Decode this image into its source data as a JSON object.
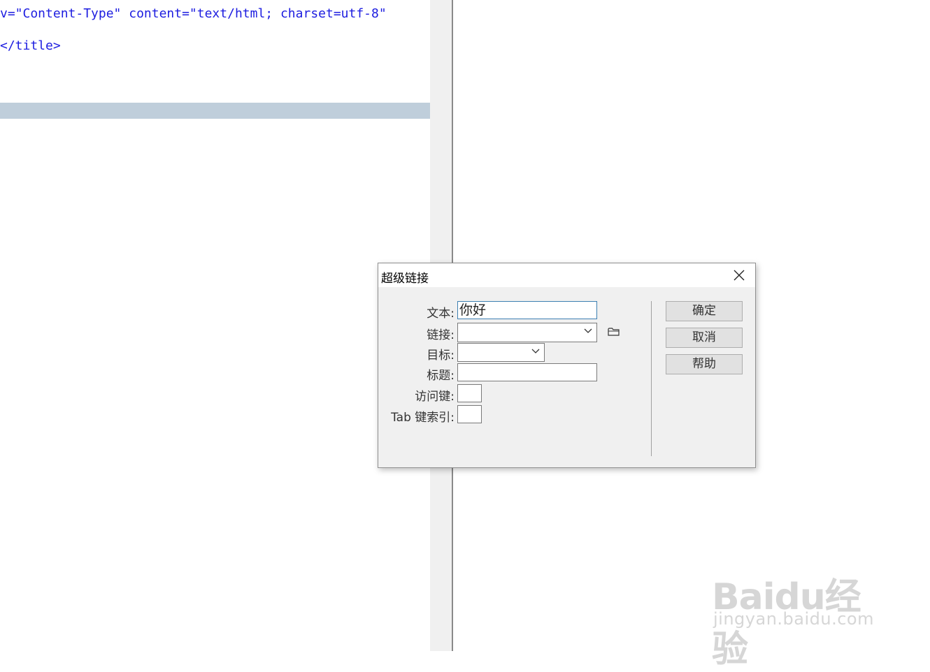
{
  "editor": {
    "lines": [
      "v=\"Content-Type\" content=\"text/html; charset=utf-8\"",
      "</title>"
    ]
  },
  "dialog": {
    "title": "超级链接",
    "fields": {
      "text_label": "文本:",
      "text_value": "你好",
      "link_label": "链接:",
      "link_value": "",
      "target_label": "目标:",
      "target_value": "",
      "title_label": "标题:",
      "title_value": "",
      "accesskey_label": "访问键:",
      "accesskey_value": "",
      "tabindex_label": "Tab 键索引:",
      "tabindex_value": ""
    },
    "buttons": {
      "ok": "确定",
      "cancel": "取消",
      "help": "帮助"
    }
  },
  "watermark": {
    "main": "Baidu经验",
    "sub": "jingyan.baidu.com"
  }
}
